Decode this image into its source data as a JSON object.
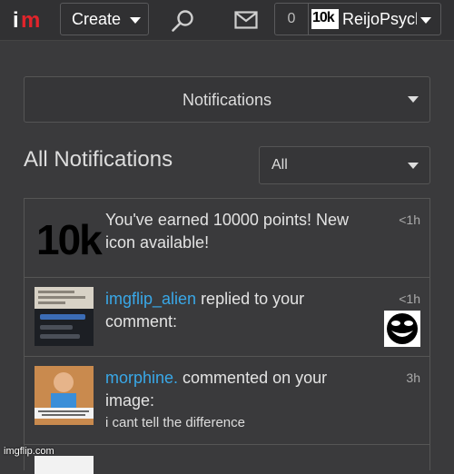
{
  "header": {
    "create_label": "Create",
    "notification_count": "0",
    "avatar_text": "10k",
    "username": "ReijoPsych"
  },
  "notifications_dropdown": {
    "label": "Notifications"
  },
  "page": {
    "title": "All Notifications",
    "filter_value": "All"
  },
  "items": [
    {
      "thumb_text": "10k",
      "text": "You've earned 10000 points! New icon available!",
      "time": "<1h"
    },
    {
      "user": "imgflip_alien",
      "action": " replied to your comment:",
      "time": "<1h"
    },
    {
      "user": "morphine.",
      "action": " commented on your image:",
      "comment": "i cant tell the difference",
      "time": "3h"
    }
  ],
  "watermark": "imgflip.com",
  "colors": {
    "background": "#3a3a3c",
    "link": "#39a8e8",
    "logo_red": "#e1242b"
  }
}
